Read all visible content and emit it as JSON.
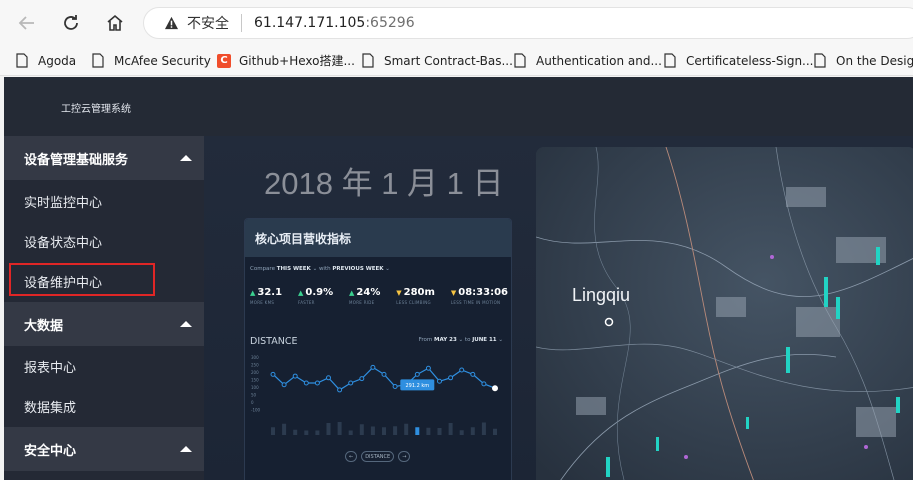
{
  "browser": {
    "security_label": "不安全",
    "url_host": "61.147.171.105",
    "url_port": ":65296",
    "bookmarks": [
      {
        "label": "Agoda",
        "icon": "page-icon"
      },
      {
        "label": "McAfee Security",
        "icon": "page-icon"
      },
      {
        "label": "Github+Hexo搭建...",
        "icon": "brand-c-icon"
      },
      {
        "label": "Smart Contract-Bas...",
        "icon": "page-icon"
      },
      {
        "label": "Authentication and...",
        "icon": "page-icon"
      },
      {
        "label": "Certificateless-Sign...",
        "icon": "page-icon"
      },
      {
        "label": "On the Design",
        "icon": "page-icon"
      }
    ]
  },
  "app": {
    "title": "工控云管理系统",
    "sidebar": {
      "groups": [
        {
          "label": "设备管理基础服务",
          "items": [
            "实时监控中心",
            "设备状态中心",
            "设备维护中心"
          ]
        },
        {
          "label": "大数据",
          "items": [
            "报表中心",
            "数据集成"
          ]
        },
        {
          "label": "安全中心",
          "items": []
        }
      ],
      "highlighted_item": "设备维护中心"
    },
    "main": {
      "date_title": "2018 年 1 月 1 日",
      "card": {
        "title": "核心项目营收指标",
        "compare_prefix": "Compare",
        "compare_this": "THIS WEEK",
        "compare_with": "with",
        "compare_prev": "PREVIOUS WEEK",
        "metrics": [
          {
            "value": "32.1",
            "trend": "up",
            "label": "MORE KMS"
          },
          {
            "value": "0.9%",
            "trend": "up",
            "label": "FASTER"
          },
          {
            "value": "24%",
            "trend": "up",
            "label": "MORE RIDE"
          },
          {
            "value": "280m",
            "trend": "down",
            "label": "LESS CLIMBING"
          },
          {
            "value": "08:33:06",
            "trend": "down",
            "label": "LESS TIME IN MOTION"
          }
        ],
        "distance_label": "DISTANCE",
        "range_from_label": "From",
        "range_from": "MAY 23",
        "range_to_label": "to",
        "range_to": "JUNE 11",
        "tooltip": "291.2 km",
        "pager_label": "DISTANCE"
      },
      "map_label": "Lingqiu"
    }
  },
  "chart_data": {
    "type": "line",
    "y_tick_labels": [
      "300",
      "250",
      "200",
      "150",
      "100",
      "50",
      "0",
      "-100"
    ],
    "values": [
      200,
      140,
      190,
      150,
      150,
      180,
      110,
      150,
      175,
      240,
      200,
      130,
      140,
      200,
      235,
      160,
      180,
      225,
      200,
      145,
      120
    ],
    "highlight_index": 13,
    "tooltip": "291.2 km"
  }
}
